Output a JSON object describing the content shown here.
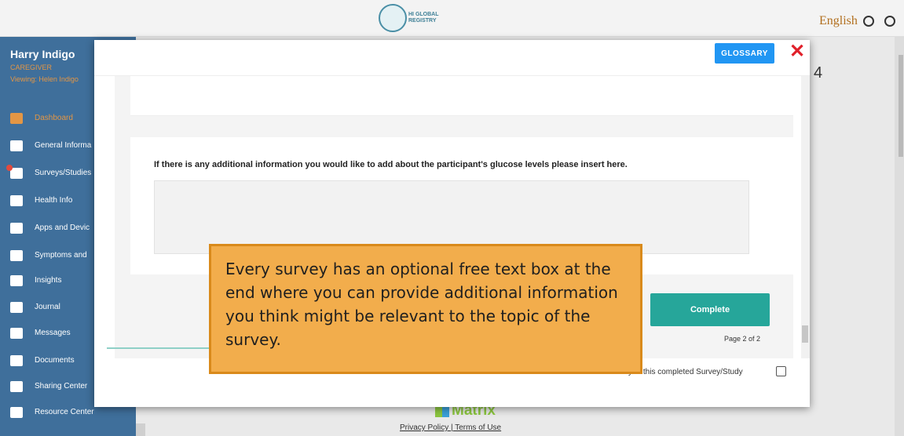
{
  "topbar": {
    "logo_text": "HI GLOBAL REGISTRY",
    "language": "English"
  },
  "sidebar": {
    "user_name": "Harry Indigo",
    "role": "CAREGIVER",
    "viewing": "Viewing: Helen Indigo",
    "items": [
      {
        "label": "Dashboard",
        "icon": "home-icon",
        "active": true
      },
      {
        "label": "General Informa",
        "icon": "id-card-icon"
      },
      {
        "label": "Surveys/Studies",
        "icon": "document-icon",
        "badge": true
      },
      {
        "label": "Health Info",
        "icon": "medical-plus-icon"
      },
      {
        "label": "Apps and Devic",
        "icon": "laptop-icon"
      },
      {
        "label": "Symptoms and",
        "icon": "heartbeat-icon"
      },
      {
        "label": "Insights",
        "icon": "chart-icon"
      },
      {
        "label": "Journal",
        "icon": "journal-icon"
      },
      {
        "label": "Messages",
        "icon": "mail-icon"
      },
      {
        "label": "Documents",
        "icon": "folder-icon"
      },
      {
        "label": "Sharing Center",
        "icon": "share-icon"
      },
      {
        "label": "Resource Center",
        "icon": "resources-icon"
      }
    ]
  },
  "background": {
    "glyph": "4"
  },
  "footer": {
    "brand": "Matrix",
    "links": "Privacy Policy | Terms of Use"
  },
  "modal": {
    "glossary_label": "GLOSSARY",
    "close_label": "✕",
    "question": "If there is any additional information you would like to add about the participant's glucose levels please insert here.",
    "textarea_value": "",
    "complete_label": "Complete",
    "page_indicator": "Page 2 of 2",
    "copy_text": "y of this completed Survey/Study",
    "copy_checked": false
  },
  "callout": {
    "text": "Every survey has an optional free text box at the end where you can provide additional information you think might be relevant to the topic of the survey."
  },
  "colors": {
    "sidebar": "#3f6f9b",
    "accent_orange": "#e39645",
    "glossary": "#2196f3",
    "complete": "#26a69a",
    "close": "#e0202a",
    "callout_fill": "#f2ad4c",
    "callout_border": "#d98a1b"
  }
}
